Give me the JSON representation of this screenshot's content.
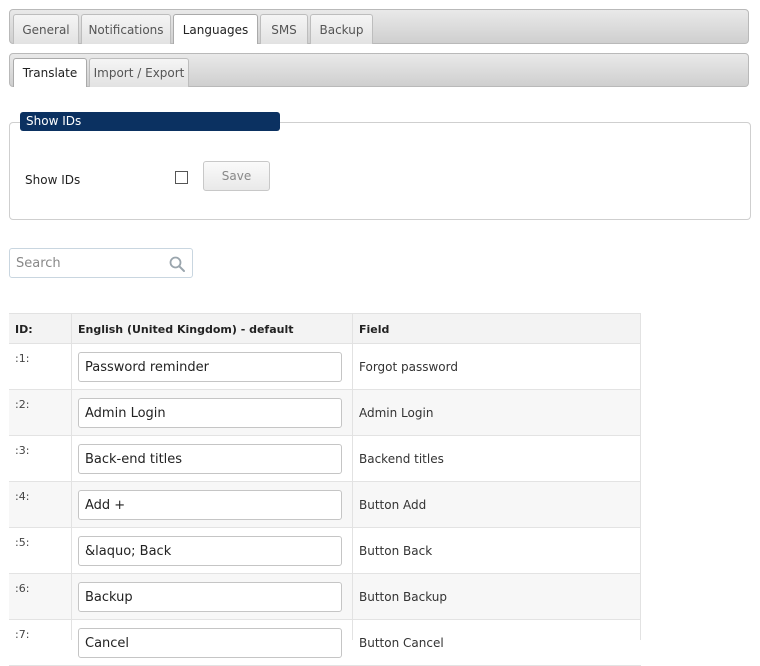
{
  "main_tabs": [
    {
      "label": "General"
    },
    {
      "label": "Notifications"
    },
    {
      "label": "Languages"
    },
    {
      "label": "SMS"
    },
    {
      "label": "Backup"
    }
  ],
  "sub_tabs": [
    {
      "label": "Translate"
    },
    {
      "label": "Import / Export"
    }
  ],
  "show_ids_section": {
    "legend": "Show IDs",
    "label": "Show IDs",
    "save_label": "Save"
  },
  "search": {
    "placeholder": "Search"
  },
  "table": {
    "headers": {
      "id": "ID:",
      "english": "English (United Kingdom) - default",
      "field": "Field"
    },
    "rows": [
      {
        "id": ":1:",
        "value": "Password reminder",
        "field": "Forgot password"
      },
      {
        "id": ":2:",
        "value": "Admin Login",
        "field": "Admin Login"
      },
      {
        "id": ":3:",
        "value": "Back-end titles",
        "field": "Backend titles"
      },
      {
        "id": ":4:",
        "value": "Add +",
        "field": "Button Add"
      },
      {
        "id": ":5:",
        "value": "&laquo; Back",
        "field": "Button Back"
      },
      {
        "id": ":6:",
        "value": "Backup",
        "field": "Button Backup"
      },
      {
        "id": ":7:",
        "value": "Cancel",
        "field": "Button Cancel"
      }
    ]
  },
  "colors": {
    "legend_bg": "#0b3161"
  }
}
